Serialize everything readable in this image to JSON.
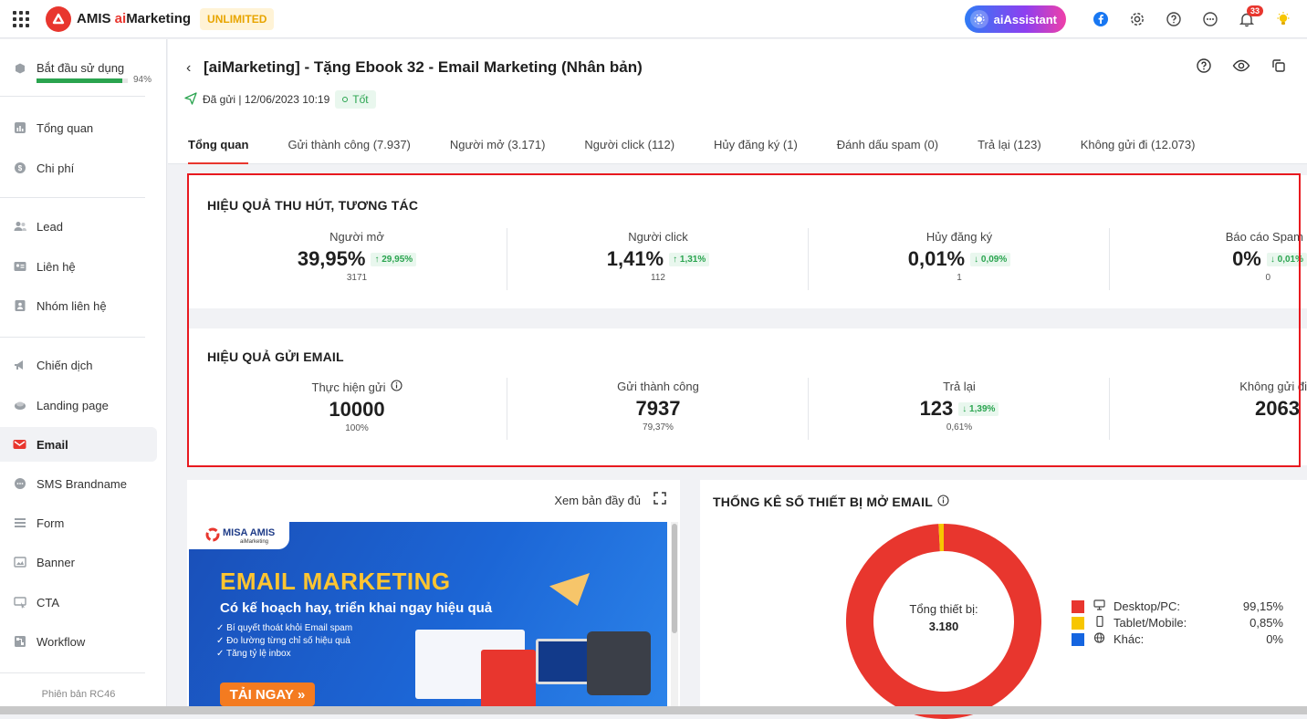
{
  "topbar": {
    "app_name_prefix": "AMIS ",
    "app_name_accent": "ai",
    "app_name_suffix": "Marketing",
    "plan_badge": "UNLIMITED",
    "assistant_label": "aiAssistant",
    "notification_count": "33"
  },
  "sidebar": {
    "getting_started": {
      "label": "Bắt đầu sử dụng",
      "progress_percent": 94,
      "progress_text": "94%"
    },
    "items": [
      {
        "label": "Tổng quan",
        "icon": "chart-icon"
      },
      {
        "label": "Chi phí",
        "icon": "cost-icon"
      },
      {
        "label": "Lead",
        "icon": "lead-icon"
      },
      {
        "label": "Liên hệ",
        "icon": "contact-card-icon"
      },
      {
        "label": "Nhóm liên hệ",
        "icon": "contact-group-icon"
      },
      {
        "label": "Chiến dịch",
        "icon": "megaphone-icon"
      },
      {
        "label": "Landing page",
        "icon": "landing-page-icon"
      },
      {
        "label": "Email",
        "icon": "email-icon",
        "active": true
      },
      {
        "label": "SMS Brandname",
        "icon": "sms-icon"
      },
      {
        "label": "Form",
        "icon": "form-icon"
      },
      {
        "label": "Banner",
        "icon": "banner-icon"
      },
      {
        "label": "CTA",
        "icon": "cta-icon"
      },
      {
        "label": "Workflow",
        "icon": "workflow-icon"
      }
    ],
    "version": "Phiên bản RC46"
  },
  "header": {
    "title": "[aiMarketing] - Tặng Ebook 32 - Email Marketing (Nhân bản)",
    "sent_info": "Đã gửi | 12/06/2023 10:19",
    "status": "Tốt",
    "tabs": [
      {
        "label": "Tổng quan",
        "active": true
      },
      {
        "label": "Gửi thành công (7.937)"
      },
      {
        "label": "Người mở (3.171)"
      },
      {
        "label": "Người click (112)"
      },
      {
        "label": "Hủy đăng ký (1)"
      },
      {
        "label": "Đánh dấu spam (0)"
      },
      {
        "label": "Trả lại (123)"
      },
      {
        "label": "Không gửi đi (12.073)"
      }
    ]
  },
  "engagement": {
    "title": "HIỆU QUẢ THU HÚT, TƯƠNG TÁC",
    "metrics": [
      {
        "label": "Người mở",
        "value": "39,95%",
        "trend": "↑ 29,95%",
        "count": "3171"
      },
      {
        "label": "Người click",
        "value": "1,41%",
        "trend": "↑ 1,31%",
        "count": "112"
      },
      {
        "label": "Hủy đăng ký",
        "value": "0,01%",
        "trend": "↓ 0,09%",
        "count": "1"
      },
      {
        "label": "Báo cáo Spam",
        "value": "0%",
        "trend": "↓ 0,01%",
        "count": "0"
      }
    ]
  },
  "sending": {
    "title": "HIỆU QUẢ GỬI EMAIL",
    "metrics": [
      {
        "label": "Thực hiện gửi",
        "value": "10000",
        "sub": "100%"
      },
      {
        "label": "Gửi thành công",
        "value": "7937",
        "sub": "79,37%"
      },
      {
        "label": "Trả lại",
        "value": "123",
        "trend": "↓ 1,39%",
        "sub": "0,61%"
      },
      {
        "label": "Không gửi đi",
        "value": "2063",
        "sub": ""
      }
    ]
  },
  "preview": {
    "view_full": "Xem bản đầy đủ",
    "brand_name": "MISA AMIS",
    "brand_sub": "aiMarketing",
    "headline": "EMAIL MARKETING",
    "subheadline": "Có kế hoạch hay, triển khai ngay hiệu quả",
    "bullets": [
      "Bí quyết thoát khỏi Email spam",
      "Đo lường từng chỉ số hiệu quả",
      "Tăng tỷ lệ inbox"
    ],
    "cta": "TẢI NGAY"
  },
  "devices": {
    "title": "THỐNG KÊ SỐ THIẾT BỊ MỞ EMAIL",
    "total_label": "Tổng thiết bị:",
    "total_value": "3.180",
    "legend": [
      {
        "label": "Desktop/PC:",
        "value": "99,15%",
        "color": "#e8362e",
        "icon": "monitor-icon"
      },
      {
        "label": "Tablet/Mobile:",
        "value": "0,85%",
        "color": "#f7c600",
        "icon": "mobile-icon"
      },
      {
        "label": "Khác:",
        "value": "0%",
        "color": "#1565e0",
        "icon": "globe-icon"
      }
    ]
  }
}
